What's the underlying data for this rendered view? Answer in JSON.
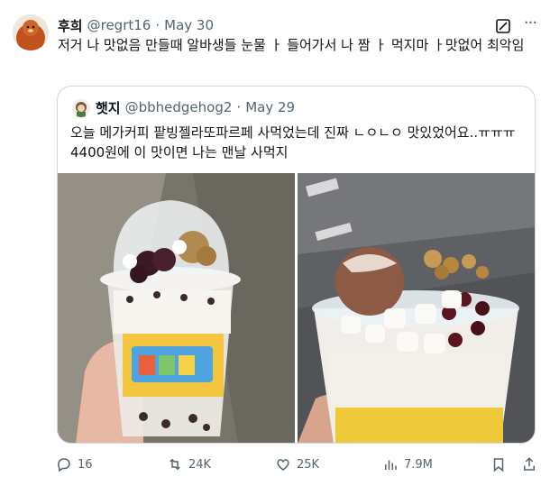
{
  "tweet": {
    "author_name": "후희",
    "author_handle": "@regrt16",
    "separator": "·",
    "date": "May 30",
    "text": "저거    나 맛없음 만들때 알바생들 눈물     ㅏ 들어가서     나 짬  ㅏ 먹지마    ㅏ맛없어 최악임"
  },
  "quoted": {
    "author_name": "햇지",
    "author_handle": "@bbhedgehog2",
    "separator": "·",
    "date": "May 29",
    "text_line1": "오늘 메가커피 팥빙젤라또파르페 사먹었는데 진짜 ㄴㅇㄴㅇ 맛있었어요..ㅠㅠㅠ",
    "text_line2": "4400원에 이 맛이면 나는 맨날 사먹지"
  },
  "actions": {
    "replies": "16",
    "retweets": "24K",
    "likes": "25K",
    "views": "7.9M"
  },
  "colors": {
    "text": "#0f1419",
    "secondary": "#536471",
    "border": "#cfd9de"
  },
  "icons": [
    "grok-icon",
    "more-icon",
    "reply-icon",
    "retweet-icon",
    "like-icon",
    "views-icon",
    "bookmark-icon",
    "share-icon"
  ]
}
